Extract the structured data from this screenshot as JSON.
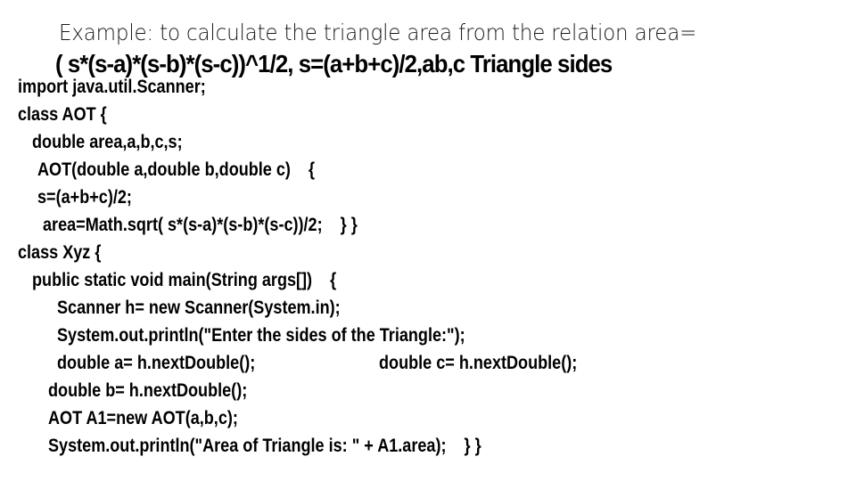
{
  "slide": {
    "title": "Example: to calculate the triangle area from the relation area=",
    "formula": "( s*(s-a)*(s-b)*(s-c))^1/2, s=(a+b+c)/2,ab,c Triangle sides",
    "code_lines": [
      "import java.util.Scanner;",
      "class AOT {",
      "double area,a,b,c,s;",
      "AOT(double a,double b,double c)    {",
      "s=(a+b+c)/2;",
      "area=Math.sqrt( s*(s-a)*(s-b)*(s-c))/2;    } }",
      "class Xyz {",
      "public static void main(String args[])    {",
      "Scanner h= new Scanner(System.in);",
      "System.out.println(\"Enter the sides of the Triangle:\");",
      "double a= h.nextDouble();",
      "double c= h.nextDouble();",
      "double b= h.nextDouble();",
      "AOT A1=new AOT(a,b,c);",
      "System.out.println(\"Area of Triangle is: \" + A1.area);    } }"
    ]
  }
}
